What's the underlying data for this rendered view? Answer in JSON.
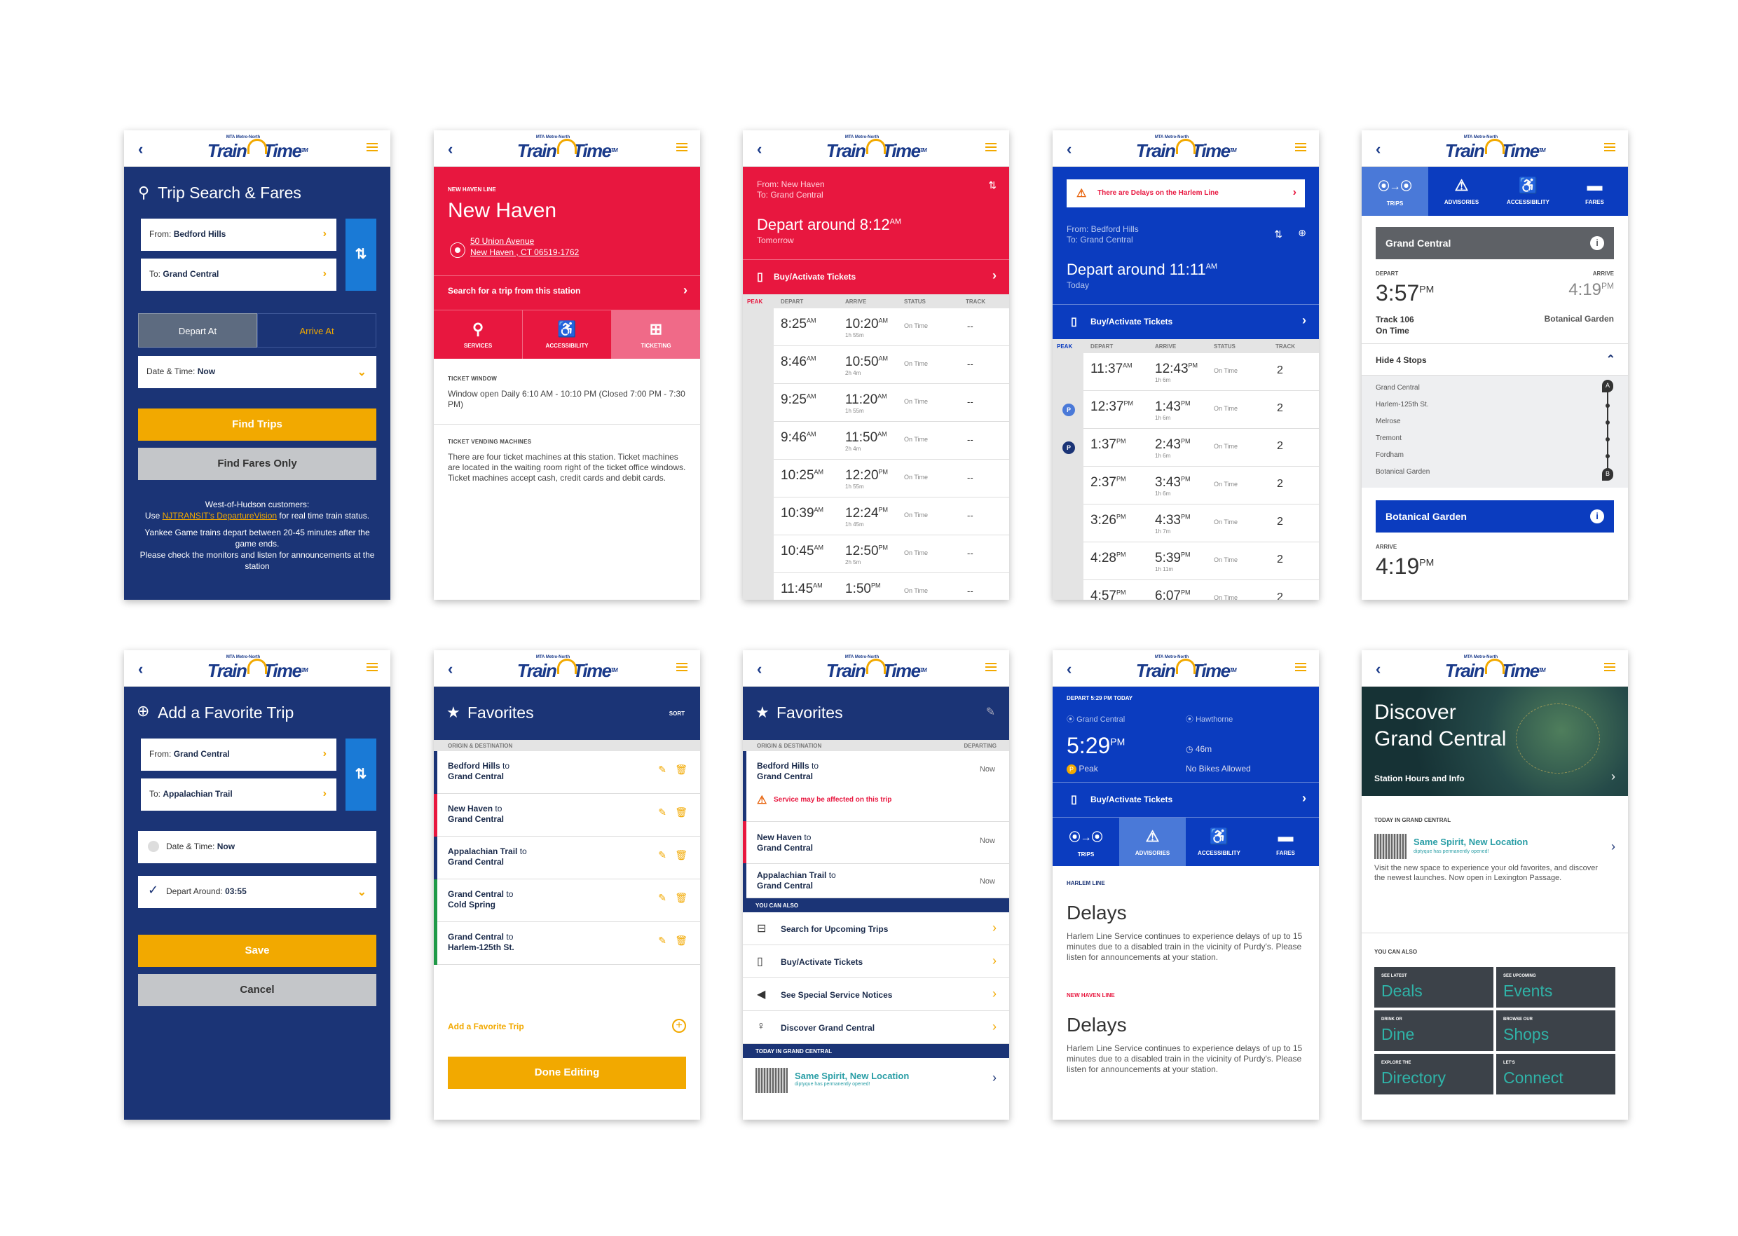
{
  "brand": {
    "logo_sub": "MTA Metro-North",
    "logo_a": "Train",
    "logo_b": "Time",
    "logo_tm": "TM",
    "back": "‹",
    "colors": {
      "navy": "#1b3476",
      "red": "#e8173f",
      "blue": "#0b3cbf",
      "yellow": "#f2a900",
      "teal": "#2fb3a8"
    }
  },
  "s1": {
    "title": "Trip Search & Fares",
    "from": "From:",
    "from_v": "Bedford Hills",
    "to": "To:",
    "to_v": "Grand Central",
    "depart_at": "Depart At",
    "arrive_at": "Arrive At",
    "dt": "Date & Time:",
    "dt_v": "Now",
    "find_trips": "Find Trips",
    "find_fares": "Find Fares Only",
    "note1": "West-of-Hudson customers:",
    "note2a": "Use ",
    "note2_link": "NJTRANSIT's DepartureVision",
    "note2b": " for real time train status.",
    "note3": "Yankee Game trains depart between 20-45 minutes after the game ends.",
    "note4": "Please check the monitors and listen for announcements at the station"
  },
  "s2": {
    "line": "NEW HAVEN LINE",
    "station": "New Haven",
    "addr1": "50 Union Avenue",
    "addr2": "New Haven , CT 06519-1762",
    "search": "Search for a trip from this station",
    "tabs": [
      "SERVICES",
      "ACCESSIBILITY",
      "TICKETING"
    ],
    "tw_h": "TICKET WINDOW",
    "tw": "Window open Daily  6:10 AM - 10:10 PM (Closed 7:00 PM - 7:30 PM)",
    "tvm_h": "TICKET VENDING MACHINES",
    "tvm": "There are four ticket machines at this station. Ticket machines are located in the waiting room right of the ticket office windows.  Ticket machines accept cash, credit cards and debit cards."
  },
  "s3": {
    "from": "From: New Haven",
    "to": "To: Grand Central",
    "dep": "Depart around 8:12",
    "dep_sup": "AM",
    "when": "Tomorrow",
    "buy": "Buy/Activate Tickets",
    "cols": [
      "PEAK",
      "DEPART",
      "ARRIVE",
      "STATUS",
      "TRACK"
    ],
    "rows": [
      [
        "8:25",
        "AM",
        "10:20",
        "AM",
        "1h 55m",
        "On Time",
        "--"
      ],
      [
        "8:46",
        "AM",
        "10:50",
        "AM",
        "2h 4m",
        "On Time",
        "--"
      ],
      [
        "9:25",
        "AM",
        "11:20",
        "AM",
        "1h 55m",
        "On Time",
        "--"
      ],
      [
        "9:46",
        "AM",
        "11:50",
        "AM",
        "2h 4m",
        "On Time",
        "--"
      ],
      [
        "10:25",
        "AM",
        "12:20",
        "PM",
        "1h 55m",
        "On Time",
        "--"
      ],
      [
        "10:39",
        "AM",
        "12:24",
        "PM",
        "1h 45m",
        "On Time",
        "--"
      ],
      [
        "10:45",
        "AM",
        "12:50",
        "PM",
        "2h 5m",
        "On Time",
        "--"
      ],
      [
        "11:45",
        "AM",
        "1:50",
        "PM",
        "",
        "On Time",
        "--"
      ]
    ]
  },
  "s4": {
    "alert": "There are Delays on the Harlem Line",
    "from": "From: Bedford Hills",
    "to": "To: Grand Central",
    "dep": "Depart around 11:11",
    "dep_sup": "AM",
    "when": "Today",
    "buy": "Buy/Activate Tickets",
    "cols": [
      "PEAK",
      "DEPART",
      "ARRIVE",
      "STATUS",
      "TRACK"
    ],
    "rows": [
      [
        "",
        "11:37",
        "AM",
        "12:43",
        "PM",
        "1h 6m",
        "On Time",
        "2"
      ],
      [
        "P",
        "12:37",
        "PM",
        "1:43",
        "PM",
        "1h 6m",
        "On Time",
        "2"
      ],
      [
        "P",
        "1:37",
        "PM",
        "2:43",
        "PM",
        "1h 6m",
        "On Time",
        "2"
      ],
      [
        "",
        "2:37",
        "PM",
        "3:43",
        "PM",
        "1h 6m",
        "On Time",
        "2"
      ],
      [
        "",
        "3:26",
        "PM",
        "4:33",
        "PM",
        "1h 7m",
        "On Time",
        "2"
      ],
      [
        "",
        "4:28",
        "PM",
        "5:39",
        "PM",
        "1h 11m",
        "On Time",
        "2"
      ],
      [
        "",
        "4:57",
        "PM",
        "6:07",
        "PM",
        "",
        "On Time",
        "2"
      ]
    ]
  },
  "s5": {
    "tabs": [
      "TRIPS",
      "ADVISORIES",
      "ACCESSIBILITY",
      "FARES"
    ],
    "origin": "Grand Central",
    "depart_l": "DEPART",
    "arrive_l": "ARRIVE",
    "dep": "3:57",
    "dep_s": "PM",
    "arr": "4:19",
    "arr_s": "PM",
    "track": "Track 106",
    "status": "On Time",
    "dest_small": "Botanical Garden",
    "hide": "Hide 4 Stops",
    "stops": [
      "Grand Central",
      "Harlem-125th St.",
      "Melrose",
      "Tremont",
      "Fordham",
      "Botanical Garden"
    ],
    "dest": "Botanical Garden",
    "arr2": "4:19",
    "arr2_s": "PM"
  },
  "s6": {
    "title": "Add a Favorite Trip",
    "from": "From:",
    "from_v": "Grand Central",
    "to": "To:",
    "to_v": "Appalachian Trail",
    "dt": "Date & Time:",
    "dt_v": "Now",
    "dep": "Depart Around:",
    "dep_v": "03:55",
    "save": "Save",
    "cancel": "Cancel"
  },
  "s7": {
    "title": "Favorites",
    "sort": "SORT",
    "hdr": "ORIGIN & DESTINATION",
    "to": "to",
    "items": [
      [
        "Bedford Hills",
        "Grand Central"
      ],
      [
        "New Haven",
        "Grand Central"
      ],
      [
        "Appalachian Trail",
        "Grand Central"
      ],
      [
        "Grand Central",
        "Cold Spring"
      ],
      [
        "Grand Central",
        "Harlem-125th St."
      ]
    ],
    "add": "Add a Favorite Trip",
    "done": "Done Editing"
  },
  "s8": {
    "title": "Favorites",
    "hdr": "ORIGIN & DESTINATION",
    "hdr_r": "DEPARTING",
    "to": "to",
    "items": [
      [
        "Bedford Hills",
        "Grand Central",
        "Now"
      ],
      [
        "New Haven",
        "Grand Central",
        "Now"
      ],
      [
        "Appalachian Trail",
        "Grand Central",
        "Now"
      ]
    ],
    "warn": "Service may be affected on this trip",
    "also": "YOU CAN ALSO",
    "links": [
      "Search for Upcoming Trips",
      "Buy/Activate Tickets",
      "See Special Service Notices",
      "Discover Grand Central"
    ],
    "today": "TODAY IN GRAND CENTRAL",
    "promo": "Same Spirit, New Location",
    "promo_sub": "diptyque has permanently opened!"
  },
  "s9": {
    "hdr": "DEPART 5:29 PM TODAY",
    "from": "Grand Central",
    "to": "Hawthorne",
    "time": "5:29",
    "time_s": "PM",
    "dur": "46m",
    "peak": "Peak",
    "bikes": "No Bikes Allowed",
    "buy": "Buy/Activate Tickets",
    "tabs": [
      "TRIPS",
      "ADVISORIES",
      "ACCESSIBILITY",
      "FARES"
    ],
    "l1": "HARLEM LINE",
    "h1": "Delays",
    "p1": "Harlem Line Service continues to experience delays of up to 15 minutes due to a disabled train in the vicinity of Purdy's. Please listen for announcements at your station.",
    "l2": "NEW HAVEN LINE",
    "h2": "Delays",
    "p2": "Harlem Line Service continues to experience delays of up to 15 minutes due to a disabled train in the vicinity of Purdy's. Please listen for announcements at your station."
  },
  "s10": {
    "h1": "Discover",
    "h2": "Grand Central",
    "hours": "Station Hours and Info",
    "today": "TODAY IN GRAND CENTRAL",
    "promo": "Same Spirit, New Location",
    "promo_sub": "diptyque has permanently opened!",
    "promo_desc": "Visit the new space to experience your old favorites, and discover the newest launches. Now open in Lexington Passage.",
    "also": "YOU CAN ALSO",
    "tiles": [
      [
        "SEE LATEST",
        "Deals"
      ],
      [
        "SEE UPCOMING",
        "Events"
      ],
      [
        "DRINK OR",
        "Dine"
      ],
      [
        "BROWSE OUR",
        "Shops"
      ],
      [
        "EXPLORE THE",
        "Directory"
      ],
      [
        "LET'S",
        "Connect"
      ]
    ]
  }
}
